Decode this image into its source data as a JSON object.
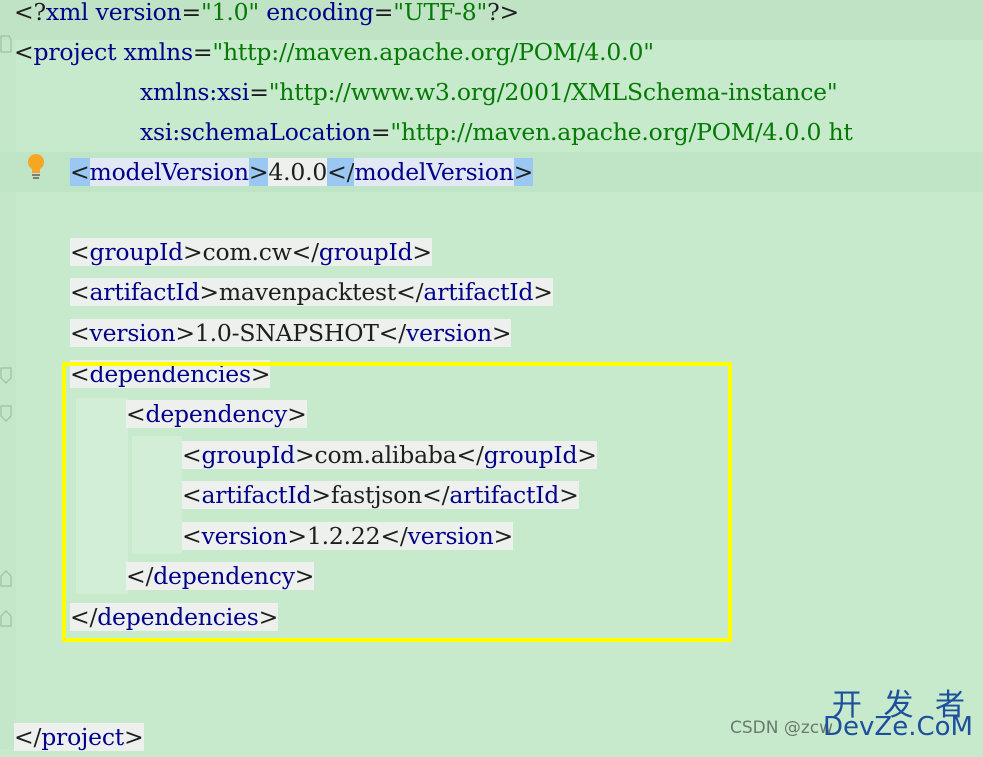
{
  "editor": {
    "lines": [
      {
        "parts": [
          [
            "p",
            "<?"
          ],
          [
            "t",
            "xml"
          ],
          [
            "a",
            " version"
          ],
          [
            "p",
            "="
          ],
          [
            "s",
            "\"1.0\""
          ],
          [
            "a",
            " encoding"
          ],
          [
            "p",
            "="
          ],
          [
            "s",
            "\"UTF-8\""
          ],
          [
            "p",
            "?>"
          ]
        ]
      },
      {
        "parts": [
          [
            "p",
            "<"
          ],
          [
            "t",
            "project"
          ],
          [
            "a",
            " xmlns"
          ],
          [
            "p",
            "="
          ],
          [
            "s",
            "\"http://maven.apache.org/POM/4.0.0\""
          ]
        ]
      },
      {
        "parts": [
          [
            "a",
            "xmlns:xsi"
          ],
          [
            "p",
            "="
          ],
          [
            "s",
            "\"http://www.w3.org/2001/XMLSchema-instance\""
          ]
        ]
      },
      {
        "parts": [
          [
            "a",
            "xsi:schemaLocation"
          ],
          [
            "p",
            "="
          ],
          [
            "s",
            "\"http://maven.apache.org/POM/4.0.0 ht"
          ]
        ]
      },
      {
        "parts": [
          [
            "p",
            "<"
          ],
          [
            "t",
            "modelVersion"
          ],
          [
            "p",
            ">"
          ],
          [
            "v",
            "4.0.0"
          ],
          [
            "p",
            "</"
          ],
          [
            "t",
            "modelVersion"
          ],
          [
            "p",
            ">"
          ]
        ]
      },
      {
        "parts": []
      },
      {
        "parts": [
          [
            "p",
            "<"
          ],
          [
            "t",
            "groupId"
          ],
          [
            "p",
            ">"
          ],
          [
            "v",
            "com.cw"
          ],
          [
            "p",
            "</"
          ],
          [
            "t",
            "groupId"
          ],
          [
            "p",
            ">"
          ]
        ]
      },
      {
        "parts": [
          [
            "p",
            "<"
          ],
          [
            "t",
            "artifactId"
          ],
          [
            "p",
            ">"
          ],
          [
            "v",
            "mavenpacktest"
          ],
          [
            "p",
            "</"
          ],
          [
            "t",
            "artifactId"
          ],
          [
            "p",
            ">"
          ]
        ]
      },
      {
        "parts": [
          [
            "p",
            "<"
          ],
          [
            "t",
            "version"
          ],
          [
            "p",
            ">"
          ],
          [
            "v",
            "1.0-SNAPSHOT"
          ],
          [
            "p",
            "</"
          ],
          [
            "t",
            "version"
          ],
          [
            "p",
            ">"
          ]
        ]
      },
      {
        "parts": [
          [
            "p",
            "<"
          ],
          [
            "t",
            "dependencies"
          ],
          [
            "p",
            ">"
          ]
        ]
      },
      {
        "parts": [
          [
            "p",
            "<"
          ],
          [
            "t",
            "dependency"
          ],
          [
            "p",
            ">"
          ]
        ]
      },
      {
        "parts": [
          [
            "p",
            "<"
          ],
          [
            "t",
            "groupId"
          ],
          [
            "p",
            ">"
          ],
          [
            "v",
            "com.alibaba"
          ],
          [
            "p",
            "</"
          ],
          [
            "t",
            "groupId"
          ],
          [
            "p",
            ">"
          ]
        ]
      },
      {
        "parts": [
          [
            "p",
            "<"
          ],
          [
            "t",
            "artifactId"
          ],
          [
            "p",
            ">"
          ],
          [
            "v",
            "fastjson"
          ],
          [
            "p",
            "</"
          ],
          [
            "t",
            "artifactId"
          ],
          [
            "p",
            ">"
          ]
        ]
      },
      {
        "parts": [
          [
            "p",
            "<"
          ],
          [
            "t",
            "version"
          ],
          [
            "p",
            ">"
          ],
          [
            "v",
            "1.2.22"
          ],
          [
            "p",
            "</"
          ],
          [
            "t",
            "version"
          ],
          [
            "p",
            ">"
          ]
        ]
      },
      {
        "parts": [
          [
            "p",
            "</"
          ],
          [
            "t",
            "dependency"
          ],
          [
            "p",
            ">"
          ]
        ]
      },
      {
        "parts": [
          [
            "p",
            "</"
          ],
          [
            "t",
            "dependencies"
          ],
          [
            "p",
            ">"
          ]
        ]
      },
      {
        "parts": []
      },
      {
        "parts": []
      },
      {
        "parts": [
          [
            "p",
            "</"
          ],
          [
            "t",
            "project"
          ],
          [
            "p",
            ">"
          ]
        ]
      }
    ]
  },
  "watermark": {
    "brand_cn": "开 发 者",
    "brand_en": "DevZe.CoM",
    "source": "CSDN @zcw"
  },
  "colors": {
    "background": "#c7e9cc",
    "tag": "#00008b",
    "string": "#047a04",
    "highlight_box": "#ffff00"
  },
  "icons": [
    "lightbulb-icon",
    "fold-icon"
  ]
}
